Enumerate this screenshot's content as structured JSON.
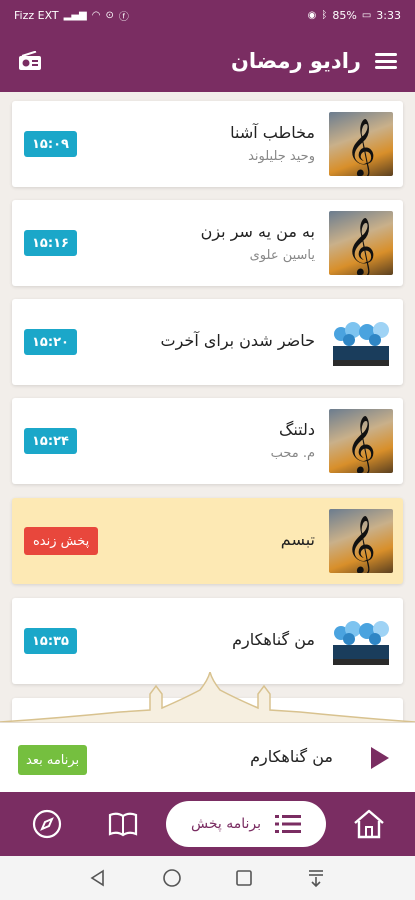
{
  "status_bar": {
    "carrier": "Fizz EXT",
    "battery": "85%",
    "time": "3:33"
  },
  "header": {
    "title": "رادیو رمضان"
  },
  "programs": [
    {
      "title": "مخاطب آشنا",
      "subtitle": "وحید جلیلوند",
      "time": "۱۵:۰۹",
      "thumb": "music",
      "live": false
    },
    {
      "title": "به من یه سر بزن",
      "subtitle": "یاسین علوی",
      "time": "۱۵:۱۶",
      "thumb": "music",
      "live": false
    },
    {
      "title": "حاضر شدن برای آخرت",
      "subtitle": "",
      "time": "۱۵:۲۰",
      "thumb": "crowd",
      "live": false
    },
    {
      "title": "دلتنگ",
      "subtitle": "م. محب",
      "time": "۱۵:۲۴",
      "thumb": "music",
      "live": false
    },
    {
      "title": "تبسم",
      "subtitle": "",
      "live_label": "پخش زنده",
      "thumb": "music",
      "live": true
    },
    {
      "title": "من گناهکارم",
      "subtitle": "",
      "time": "۱۵:۳۵",
      "thumb": "crowd",
      "live": false
    }
  ],
  "now_playing": {
    "title": "من گناهکارم",
    "next_label": "برنامه بعد"
  },
  "bottom_nav": {
    "schedule_label": "برنامه پخش"
  },
  "colors": {
    "primary": "#7a2d62",
    "time_badge": "#1ba7c9",
    "live_badge": "#e8473c",
    "next_button": "#75bf3f",
    "live_card": "#fde9b4"
  },
  "icons": {
    "header": [
      "radio-icon",
      "menu-icon"
    ],
    "nav": [
      "compass-icon",
      "book-icon",
      "list-icon",
      "home-icon"
    ],
    "system": [
      "back-icon",
      "home-circle-icon",
      "recents-icon",
      "notifications-down-icon"
    ]
  }
}
